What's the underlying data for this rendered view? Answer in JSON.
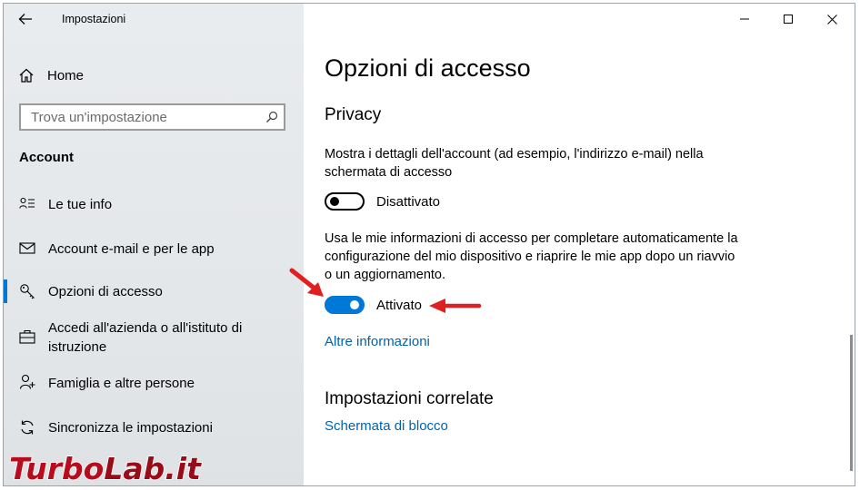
{
  "window": {
    "app_title": "Impostazioni",
    "controls": [
      "minimize",
      "maximize",
      "close"
    ]
  },
  "sidebar": {
    "home_label": "Home",
    "search_placeholder": "Trova un'impostazione",
    "section_title": "Account",
    "items": [
      {
        "label": "Le tue info",
        "icon": "person-info-icon",
        "selected": false
      },
      {
        "label": "Account e-mail e per le app",
        "icon": "mail-icon",
        "selected": false
      },
      {
        "label": "Opzioni di accesso",
        "icon": "key-icon",
        "selected": true
      },
      {
        "label": "Accedi all'azienda o all'istituto di istruzione",
        "icon": "briefcase-icon",
        "selected": false
      },
      {
        "label": "Famiglia e altre persone",
        "icon": "person-add-icon",
        "selected": false
      },
      {
        "label": "Sincronizza le impostazioni",
        "icon": "sync-icon",
        "selected": false
      }
    ]
  },
  "main": {
    "page_title": "Opzioni di accesso",
    "privacy": {
      "heading": "Privacy",
      "setting1": {
        "description": "Mostra i dettagli dell'account (ad esempio, l'indirizzo e-mail) nella schermata di accesso",
        "state_label": "Disattivato",
        "on": false
      },
      "setting2": {
        "description": "Usa le mie informazioni di accesso per completare automaticamente la configurazione del mio dispositivo e riaprire le mie app dopo un riavvio o un aggiornamento.",
        "state_label": "Attivato",
        "on": true
      },
      "more_info_link": "Altre informazioni"
    },
    "related": {
      "heading": "Impostazioni correlate",
      "link": "Schermata di blocco"
    }
  },
  "watermark": {
    "text_part1": "Turbo",
    "text_part2": "Lab.it"
  },
  "colors": {
    "accent": "#0078d7",
    "link": "#0063b1",
    "arrow": "#e02020"
  }
}
